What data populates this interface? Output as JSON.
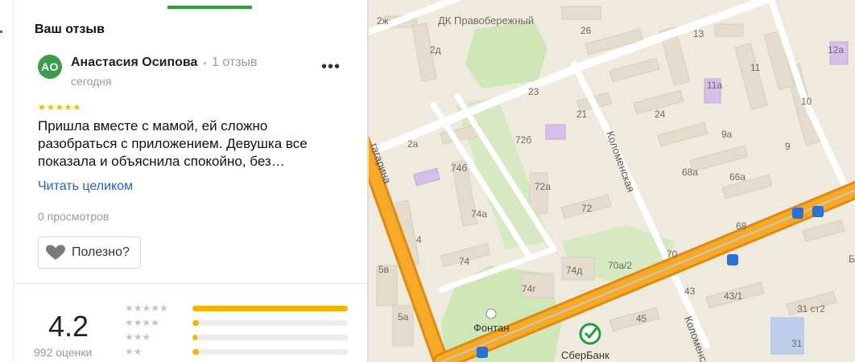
{
  "review_panel": {
    "section_title": "Ваш отзыв",
    "avatar_initials": "АО",
    "author_name": "Анастасия Осипова",
    "separator": "•",
    "author_review_count": "1 отзыв",
    "date": "сегодня",
    "more_label": "•••",
    "star_rating": 5,
    "stars_display": "★★★★★",
    "review_text": "Пришла вместе с мамой, ей сложно разобраться с приложением. Девушка все показала и объяснила спокойно, без…",
    "read_more_label": "Читать целиком",
    "views_label": "0 просмотров",
    "useful_label": "Полезно?"
  },
  "rating_summary": {
    "average": "4.2",
    "count_label": "992 оценки",
    "distribution": [
      {
        "stars": 5,
        "stars_display": "★★★★★",
        "fill": 1.0
      },
      {
        "stars": 4,
        "stars_display": "★★★★",
        "fill": 0.04
      },
      {
        "stars": 3,
        "stars_display": "★★★",
        "fill": 0.03
      },
      {
        "stars": 2,
        "stars_display": "★★",
        "fill": 0.04
      }
    ]
  },
  "map": {
    "labels": {
      "dk": "ДК Правобережный",
      "kolomenskaya_1": "Коломенская",
      "kolomenskaya_2": "Коломенская",
      "gagarina": "гагарина",
      "fontan": "Фонтан",
      "sberbank": "СберБанк"
    },
    "house_numbers": [
      "2ж",
      "26",
      "2д",
      "13",
      "12а",
      "11а",
      "11",
      "23",
      "21",
      "24",
      "10",
      "9а",
      "2а",
      "72б",
      "9",
      "74б",
      "68а",
      "66а",
      "72а",
      "72",
      "74а",
      "4",
      "68",
      "70",
      "74",
      "74д",
      "70а/2",
      "5в",
      "74г",
      "43",
      "43/1",
      "5а",
      "45",
      "31 ст2",
      "31",
      "Б"
    ],
    "colors": {
      "accent_green": "#2e9e3c",
      "link_blue": "#1e63c6",
      "star_gold": "#f4b400",
      "road_orange": "#f29a1c"
    }
  }
}
